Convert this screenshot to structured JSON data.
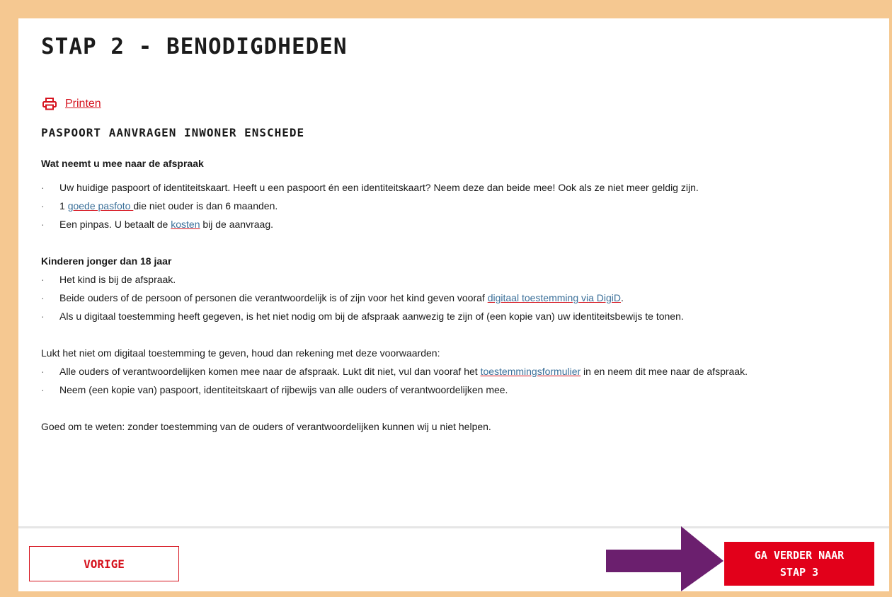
{
  "page": {
    "title": "STAP 2 - BENODIGDHEDEN",
    "print_label": "Printen",
    "subtitle": "PASPOORT AANVRAGEN INWONER ENSCHEDE"
  },
  "section1": {
    "heading": "Wat neemt u mee naar de afspraak",
    "item1": "Uw huidige paspoort of identiteitskaart. Heeft u een paspoort én een identiteitskaart? Neem deze dan beide mee! Ook als ze niet meer geldig zijn.",
    "item2_pre": "1 ",
    "item2_link": "goede pasfoto ",
    "item2_post": "die niet ouder is dan 6 maanden.",
    "item3_pre": "Een pinpas. U betaalt de ",
    "item3_link": "kosten",
    "item3_post": " bij de aanvraag."
  },
  "section2": {
    "heading": "Kinderen jonger dan 18 jaar",
    "item1": "Het kind is bij de afspraak.",
    "item2_pre": "Beide ouders of de persoon of personen die verantwoordelijk is of zijn voor het kind geven vooraf ",
    "item2_link": "digitaal toestemming via DigiD",
    "item2_post": ".",
    "item3": "Als u digitaal toestemming heeft gegeven, is het niet nodig om bij de afspraak aanwezig te zijn of (een kopie van) uw identiteitsbewijs te tonen."
  },
  "section3": {
    "intro": "Lukt het niet om digitaal toestemming te geven, houd dan rekening met deze voorwaarden:",
    "item1_pre": "Alle ouders of verantwoordelijken komen mee naar de afspraak. Lukt dit niet, vul dan vooraf het ",
    "item1_link": "toestemmingsformulier",
    "item1_post": " in en neem dit mee naar de afspraak.",
    "item2": "Neem (een kopie van) paspoort, identiteitskaart of rijbewijs van alle ouders of verantwoordelijken mee."
  },
  "note": "Goed om te weten: zonder toestemming van de ouders of verantwoordelijken kunnen wij u niet helpen.",
  "footer": {
    "prev_label": "VORIGE",
    "next_label": "GA VERDER NAAR\nSTAP 3"
  },
  "colors": {
    "accent_red": "#e2001a",
    "link_blue": "#3a6f99",
    "frame": "#f5c891",
    "arrow_purple": "#6b1f6e"
  },
  "icons": {
    "print": "printer-icon",
    "arrow": "arrow-right-icon"
  }
}
